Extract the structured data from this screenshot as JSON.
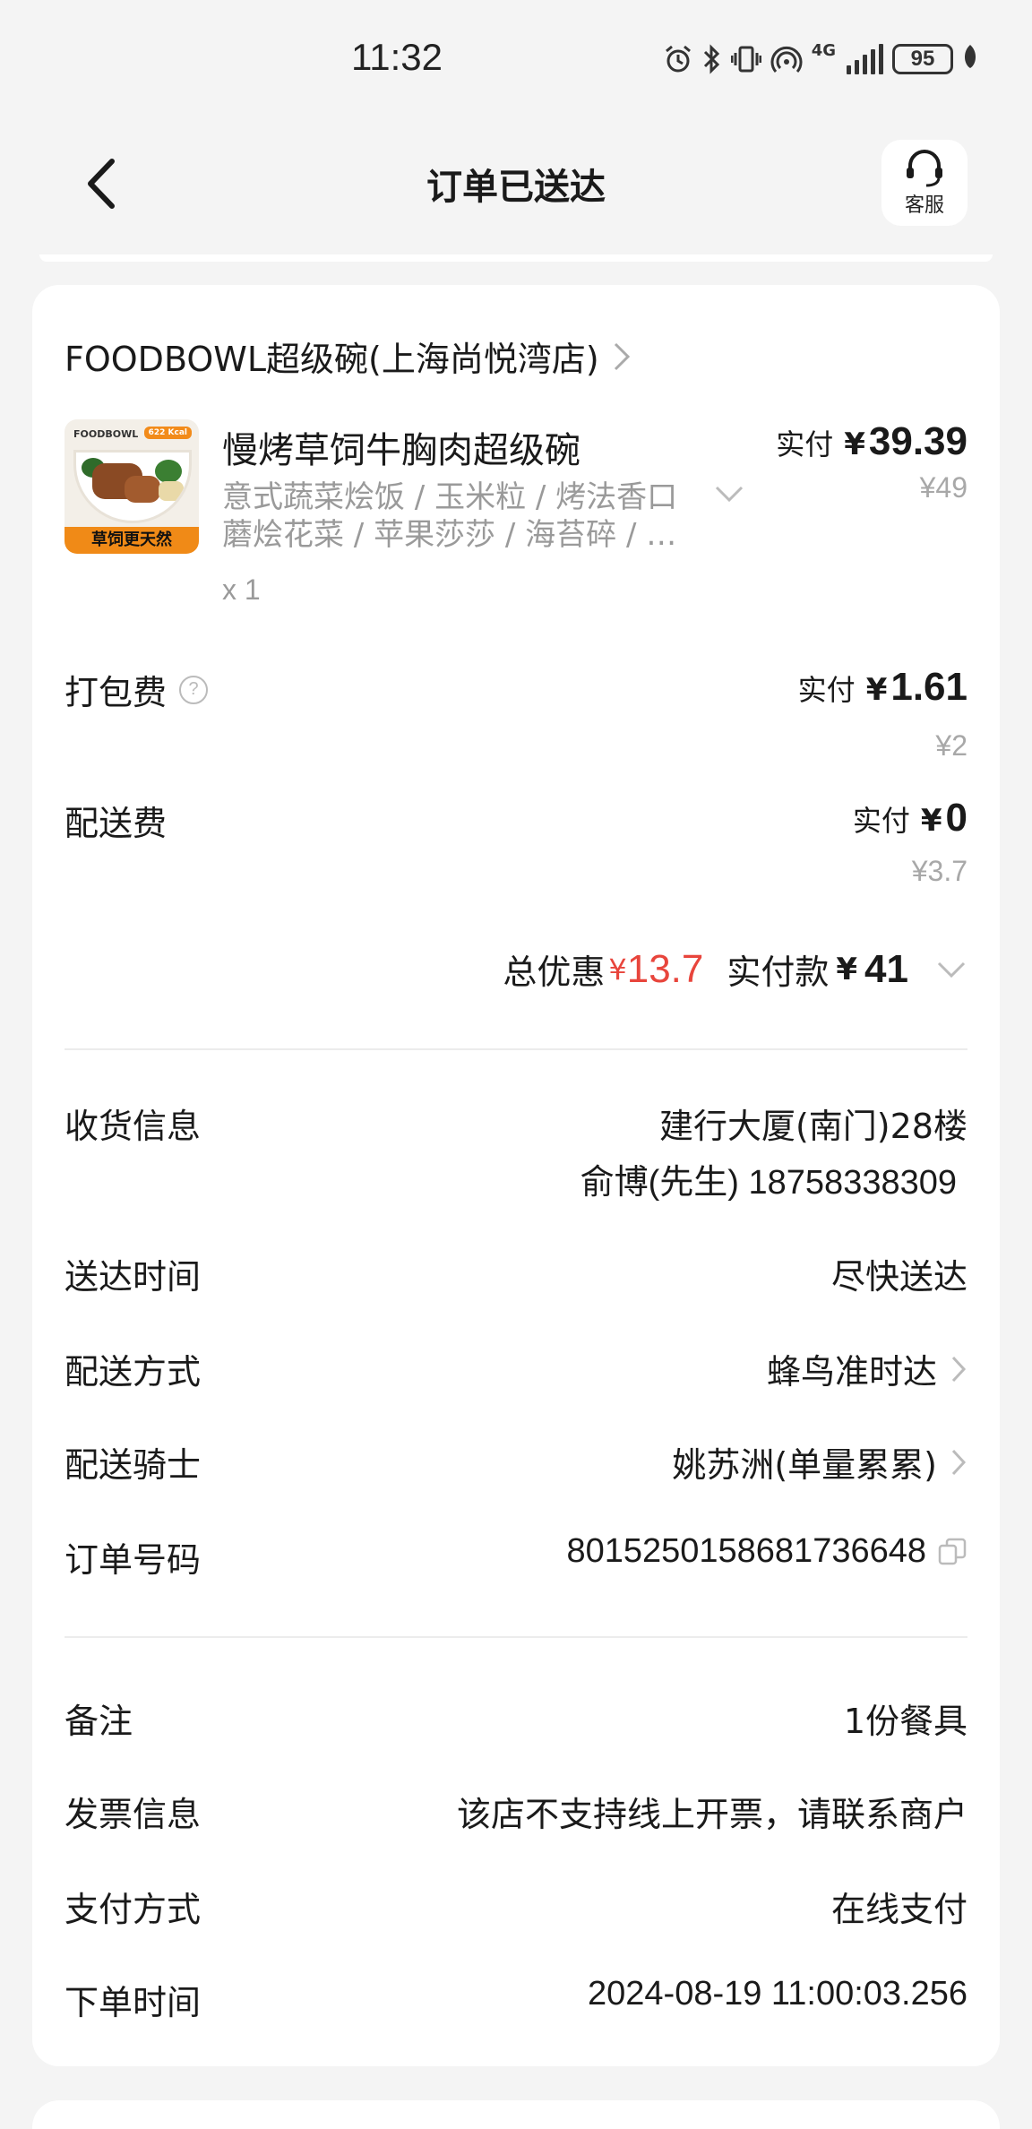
{
  "status_bar": {
    "time": "11:32",
    "network": "4G",
    "battery": "95"
  },
  "nav": {
    "title": "订单已送达",
    "service_label": "客服"
  },
  "store": {
    "name": "FOODBOWL超级碗(上海尚悦湾店)"
  },
  "item": {
    "image_brand": "FOODBOWL",
    "image_kcal": "622 Kcal",
    "image_banner": "草饲更天然",
    "name": "慢烤草饲牛胸肉超级碗",
    "spec_line1": "意式蔬菜烩饭 / 玉米粒 / 烤法香口",
    "spec_line2": "蘑烩花菜 / 苹果莎莎 / 海苔碎 / …",
    "qty": "x 1",
    "pay_label": "实付",
    "currency": "¥",
    "pay_amount": "39.39",
    "original_price": "¥49"
  },
  "fees": {
    "packing": {
      "label": "打包费",
      "pay_label": "实付",
      "currency": "¥",
      "amount": "1.61",
      "original": "¥2"
    },
    "delivery": {
      "label": "配送费",
      "pay_label": "实付",
      "currency": "¥",
      "amount": "0",
      "original": "¥3.7"
    }
  },
  "total": {
    "discount_label": "总优惠",
    "discount_currency": "¥",
    "discount_amount": "13.7",
    "pay_label": "实付款",
    "pay_currency": "¥",
    "pay_amount": "41"
  },
  "info": {
    "address_label": "收货信息",
    "address": "建行大厦(南门)28楼",
    "contact": "俞博(先生) 18758338309",
    "time_label": "送达时间",
    "time_value": "尽快送达",
    "method_label": "配送方式",
    "method_value": "蜂鸟准时达",
    "rider_label": "配送骑士",
    "rider_value": "姚苏洲(单量累累)",
    "order_no_label": "订单号码",
    "order_no": "8015250158681736648"
  },
  "extra": {
    "note_label": "备注",
    "note_value": "1份餐具",
    "invoice_label": "发票信息",
    "invoice_value": "该店不支持线上开票，请联系商户",
    "payment_label": "支付方式",
    "payment_value": "在线支付",
    "order_time_label": "下单时间",
    "order_time_value": "2024-08-19 11:00:03.256"
  },
  "colors": {
    "discount": "#e8453c",
    "background": "#f4f4f4",
    "muted": "#9a9a9a"
  }
}
